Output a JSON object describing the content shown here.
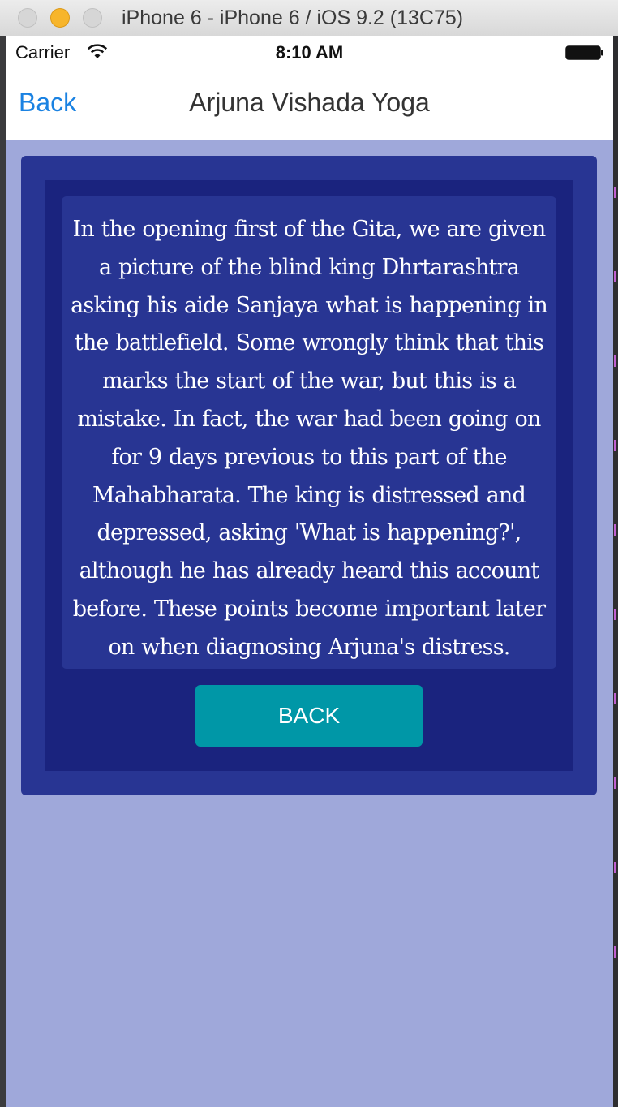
{
  "window": {
    "title": "iPhone 6 - iPhone 6 / iOS 9.2 (13C75)"
  },
  "status_bar": {
    "carrier": "Carrier",
    "time": "8:10 AM",
    "wifi_icon": "wifi-icon",
    "battery_icon": "battery-icon"
  },
  "nav_bar": {
    "back_label": "Back",
    "title": "Arjuna Vishada Yoga"
  },
  "content": {
    "body": "In the opening first of the Gita, we are given a picture of the blind king Dhrtarashtra asking his aide Sanjaya what is happening in the battlefield. Some wrongly think that this marks the start of the war, but this is a mistake. In fact, the war had been going on for 9 days previous to this part of the Mahabharata. The king is distressed and depressed, asking 'What is happening?', although he has already heard this account before. These points become important later on when diagnosing Arjuna's distress.",
    "back_button_label": "BACK"
  },
  "colors": {
    "screen_background": "#9fa8da",
    "card_outer": "#283593",
    "card_inner": "#1a237e",
    "button": "#0097a7",
    "nav_link": "#1a82e2"
  }
}
